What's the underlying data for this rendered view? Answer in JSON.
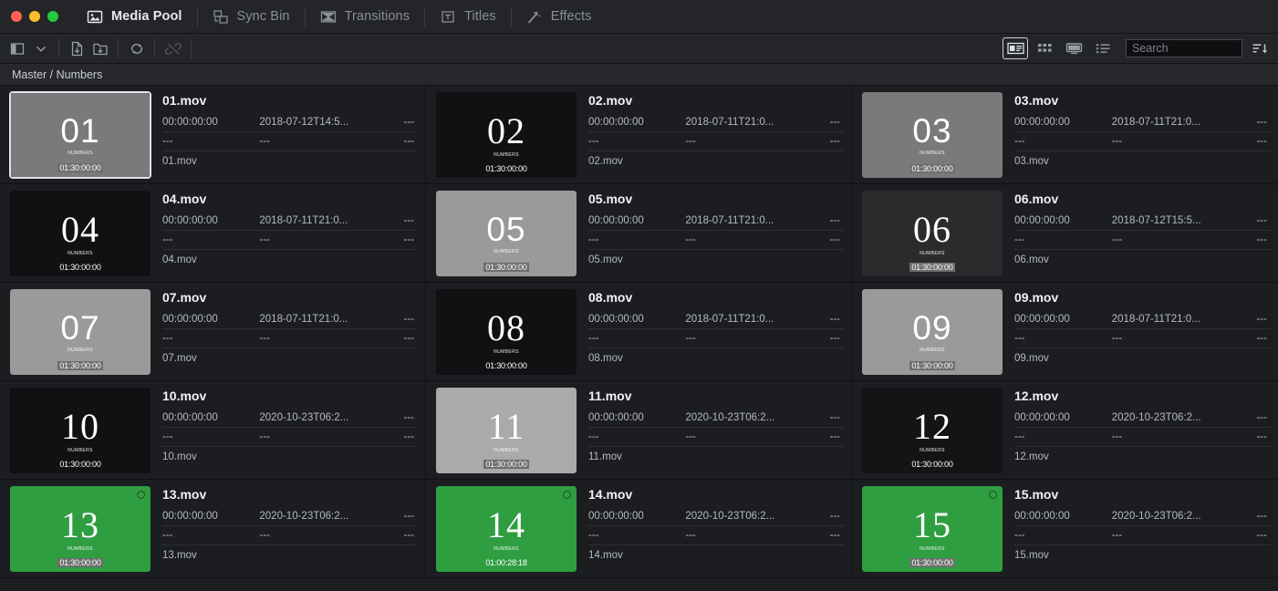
{
  "window": {
    "traffic_lights": [
      "close",
      "minimize",
      "maximize"
    ],
    "colors": {
      "close": "#ff5f57",
      "minimize": "#febc2e",
      "maximize": "#28c840"
    }
  },
  "tabs": [
    {
      "label": "Media Pool",
      "icon": "media-pool-icon",
      "active": true
    },
    {
      "label": "Sync Bin",
      "icon": "sync-bin-icon",
      "active": false
    },
    {
      "label": "Transitions",
      "icon": "transitions-icon",
      "active": false
    },
    {
      "label": "Titles",
      "icon": "titles-icon",
      "active": false
    },
    {
      "label": "Effects",
      "icon": "effects-icon",
      "active": false
    }
  ],
  "toolbar": {
    "left_buttons": [
      {
        "name": "panel-toggle-icon",
        "disabled": false
      },
      {
        "name": "chevron-down-icon",
        "disabled": false
      },
      {
        "name": "import-file-icon",
        "disabled": false
      },
      {
        "name": "import-folder-icon",
        "disabled": false
      },
      {
        "name": "sync-clips-icon",
        "disabled": false
      },
      {
        "name": "unlink-clips-icon",
        "disabled": true
      }
    ],
    "view_buttons": [
      {
        "name": "metadata-view-icon",
        "selected": true
      },
      {
        "name": "thumbnail-view-icon",
        "selected": false
      },
      {
        "name": "filmstrip-view-icon",
        "selected": false
      },
      {
        "name": "list-view-icon",
        "selected": false
      }
    ],
    "search": {
      "value": "",
      "placeholder": "Search"
    },
    "sort_button": {
      "name": "sort-order-icon",
      "label": "Sort Order"
    }
  },
  "breadcrumb": {
    "text": "Master / Numbers"
  },
  "clips": [
    {
      "title": "01.mov",
      "timecode": "00:00:00:00",
      "date": "2018-07-12T14:5...",
      "col3": "---",
      "row2": [
        "---",
        "---",
        "---"
      ],
      "filename": "01.mov",
      "thumb": {
        "number": "01",
        "sub": "NUMBERS",
        "bg": "#7a7a7a",
        "font": "sans",
        "tc": "01:30:00:00",
        "boxed": true,
        "flag": false
      },
      "selected": true
    },
    {
      "title": "02.mov",
      "timecode": "00:00:00:00",
      "date": "2018-07-11T21:0...",
      "col3": "---",
      "row2": [
        "---",
        "---",
        "---"
      ],
      "filename": "02.mov",
      "thumb": {
        "number": "02",
        "sub": "NUMBERS",
        "bg": "#111114",
        "font": "serif",
        "tc": "01:30:00:00",
        "boxed": false,
        "flag": false
      },
      "selected": false
    },
    {
      "title": "03.mov",
      "timecode": "00:00:00:00",
      "date": "2018-07-11T21:0...",
      "col3": "---",
      "row2": [
        "---",
        "---",
        "---"
      ],
      "filename": "03.mov",
      "thumb": {
        "number": "03",
        "sub": "NUMBERS",
        "bg": "#7a7a7a",
        "font": "sans",
        "tc": "01:30:00:00",
        "boxed": true,
        "flag": false
      },
      "selected": false
    },
    {
      "title": "04.mov",
      "timecode": "00:00:00:00",
      "date": "2018-07-11T21:0...",
      "col3": "---",
      "row2": [
        "---",
        "---",
        "---"
      ],
      "filename": "04.mov",
      "thumb": {
        "number": "04",
        "sub": "NUMBERS",
        "bg": "#111114",
        "font": "serif",
        "tc": "01:30:00:00",
        "boxed": false,
        "flag": false
      },
      "selected": false
    },
    {
      "title": "05.mov",
      "timecode": "00:00:00:00",
      "date": "2018-07-11T21:0...",
      "col3": "---",
      "row2": [
        "---",
        "---",
        "---"
      ],
      "filename": "05.mov",
      "thumb": {
        "number": "05",
        "sub": "NUMBERS",
        "bg": "#9a9a9a",
        "font": "sans",
        "tc": "01:30:00:00",
        "boxed": true,
        "flag": false
      },
      "selected": false
    },
    {
      "title": "06.mov",
      "timecode": "00:00:00:00",
      "date": "2018-07-12T15:5...",
      "col3": "---",
      "row2": [
        "---",
        "---",
        "---"
      ],
      "filename": "06.mov",
      "thumb": {
        "number": "06",
        "sub": "NUMBERS",
        "bg": "#2b2b2e",
        "font": "serif",
        "tc": "01:30:00:00",
        "boxed": true,
        "flag": false
      },
      "selected": false
    },
    {
      "title": "07.mov",
      "timecode": "00:00:00:00",
      "date": "2018-07-11T21:0...",
      "col3": "---",
      "row2": [
        "---",
        "---",
        "---"
      ],
      "filename": "07.mov",
      "thumb": {
        "number": "07",
        "sub": "NUMBERS",
        "bg": "#9a9a9a",
        "font": "sans",
        "tc": "01:30:00:00",
        "boxed": true,
        "flag": false
      },
      "selected": false
    },
    {
      "title": "08.mov",
      "timecode": "00:00:00:00",
      "date": "2018-07-11T21:0...",
      "col3": "---",
      "row2": [
        "---",
        "---",
        "---"
      ],
      "filename": "08.mov",
      "thumb": {
        "number": "08",
        "sub": "NUMBERS",
        "bg": "#111114",
        "font": "serif",
        "tc": "01:30:00:00",
        "boxed": false,
        "flag": false
      },
      "selected": false
    },
    {
      "title": "09.mov",
      "timecode": "00:00:00:00",
      "date": "2018-07-11T21:0...",
      "col3": "---",
      "row2": [
        "---",
        "---",
        "---"
      ],
      "filename": "09.mov",
      "thumb": {
        "number": "09",
        "sub": "NUMBERS",
        "bg": "#9a9a9a",
        "font": "sans",
        "tc": "01:30:00:00",
        "boxed": true,
        "flag": false
      },
      "selected": false
    },
    {
      "title": "10.mov",
      "timecode": "00:00:00:00",
      "date": "2020-10-23T06:2...",
      "col3": "---",
      "row2": [
        "---",
        "---",
        "---"
      ],
      "filename": "10.mov",
      "thumb": {
        "number": "10",
        "sub": "NUMBERS",
        "bg": "#111114",
        "font": "serif",
        "tc": "01:30:00:00",
        "boxed": false,
        "flag": false
      },
      "selected": false
    },
    {
      "title": "11.mov",
      "timecode": "00:00:00:00",
      "date": "2020-10-23T06:2...",
      "col3": "---",
      "row2": [
        "---",
        "---",
        "---"
      ],
      "filename": "11.mov",
      "thumb": {
        "number": "11",
        "sub": "NUMBERS",
        "bg": "#aaaaaa",
        "font": "serif",
        "tc": "01:30:00:00",
        "boxed": true,
        "flag": false
      },
      "selected": false
    },
    {
      "title": "12.mov",
      "timecode": "00:00:00:00",
      "date": "2020-10-23T06:2...",
      "col3": "---",
      "row2": [
        "---",
        "---",
        "---"
      ],
      "filename": "12.mov",
      "thumb": {
        "number": "12",
        "sub": "NUMBERS",
        "bg": "#141416",
        "font": "serif",
        "tc": "01:30:00:00",
        "boxed": false,
        "flag": false
      },
      "selected": false
    },
    {
      "title": "13.mov",
      "timecode": "00:00:00:00",
      "date": "2020-10-23T06:2...",
      "col3": "---",
      "row2": [
        "---",
        "---",
        "---"
      ],
      "filename": "13.mov",
      "thumb": {
        "number": "13",
        "sub": "NUMBERS",
        "bg": "#2f9e41",
        "font": "serif",
        "tc": "01:30:00:00",
        "boxed": true,
        "flag": true
      },
      "selected": false
    },
    {
      "title": "14.mov",
      "timecode": "00:00:00:00",
      "date": "2020-10-23T06:2...",
      "col3": "---",
      "row2": [
        "---",
        "---",
        "---"
      ],
      "filename": "14.mov",
      "thumb": {
        "number": "14",
        "sub": "NUMBERS",
        "bg": "#2f9e41",
        "font": "serif",
        "tc": "01:00:28:18",
        "boxed": false,
        "flag": true
      },
      "selected": false
    },
    {
      "title": "15.mov",
      "timecode": "00:00:00:00",
      "date": "2020-10-23T06:2...",
      "col3": "---",
      "row2": [
        "---",
        "---",
        "---"
      ],
      "filename": "15.mov",
      "thumb": {
        "number": "15",
        "sub": "NUMBERS",
        "bg": "#2f9e41",
        "font": "serif",
        "tc": "01:30:00:00",
        "boxed": true,
        "flag": true
      },
      "selected": false
    }
  ]
}
